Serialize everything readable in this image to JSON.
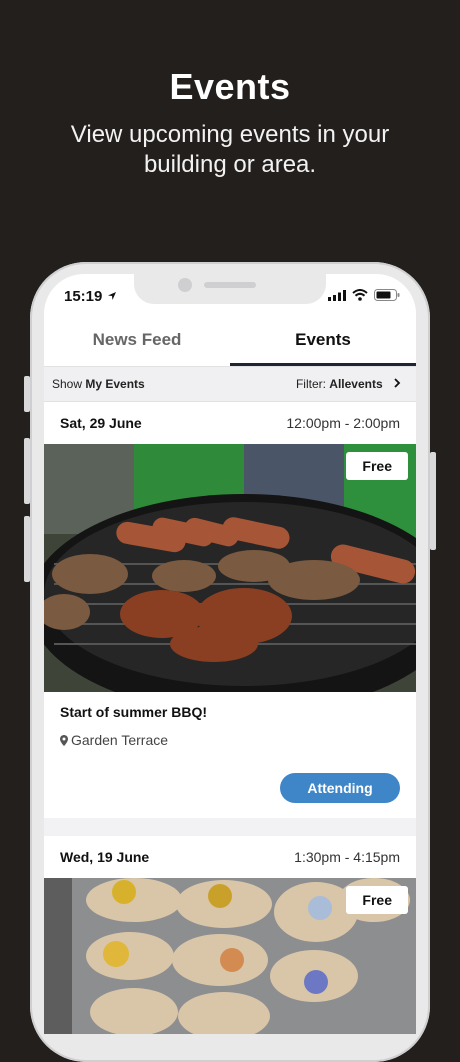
{
  "hero": {
    "title": "Events",
    "subtitle": "View upcoming events in your building or area."
  },
  "status": {
    "time": "15:19",
    "location_icon": "location-arrow-icon"
  },
  "tabs": [
    {
      "label": "News Feed",
      "active": false
    },
    {
      "label": "Events",
      "active": true
    }
  ],
  "filter": {
    "show_prefix": "Show",
    "show_value": "My Events",
    "filter_prefix": "Filter:",
    "filter_value": "Allevents"
  },
  "events": [
    {
      "date": "Sat, 29 June",
      "hours": "12:00pm - 2:00pm",
      "badge": "Free",
      "title": "Start of summer BBQ!",
      "location": "Garden Terrace",
      "action": "Attending"
    },
    {
      "date": "Wed, 19 June",
      "hours": "1:30pm - 4:15pm",
      "badge": "Free"
    }
  ],
  "colors": {
    "background": "#231f1d",
    "accent": "#3f86c9"
  }
}
